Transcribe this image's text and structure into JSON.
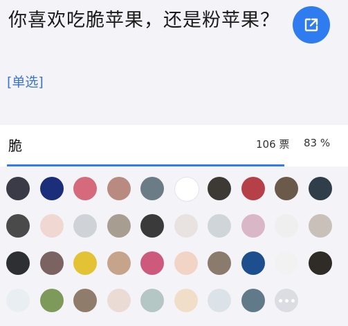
{
  "question": "你喜欢吃脆苹果，还是粉苹果？",
  "question_type": "[单选]",
  "share_icon": "external-share-icon",
  "option": {
    "label": "脆",
    "votes": "106 票",
    "percent": "83 %",
    "fraction": 0.83
  },
  "colors": {
    "accent": "#2f7bf0",
    "link": "#3b74c9"
  },
  "avatar_colors": [
    [
      "#3b3b48",
      "#1b2e7a",
      "#d46a7c",
      "#b98a7f",
      "#6c7c86",
      "#ffffff",
      "#3d3a35",
      "#b64048",
      "#6b5a4a",
      "#2f3e48"
    ],
    [
      "#4a4a4a",
      "#f1d7d2",
      "#cfd3d8",
      "#a79d90",
      "#3a3a3a",
      "#e8e3e0",
      "#cfd5d9",
      "#d9b7c6",
      "#efefef",
      "#c9c1b9"
    ],
    [
      "#2d2f33",
      "#7a6360",
      "#e3c236",
      "#c6a38b",
      "#cd5a7c",
      "#f2d4c6",
      "#8a7b6c",
      "#1d4f8f",
      "#f2f2f2",
      "#2f2b26"
    ],
    [
      "#e9eef2",
      "#7e9a5b",
      "#8f7c6b",
      "#eadbd5",
      "#b5c7c5",
      "#f1dec8",
      "#dbe2e8",
      "#607a8a",
      "more"
    ]
  ]
}
